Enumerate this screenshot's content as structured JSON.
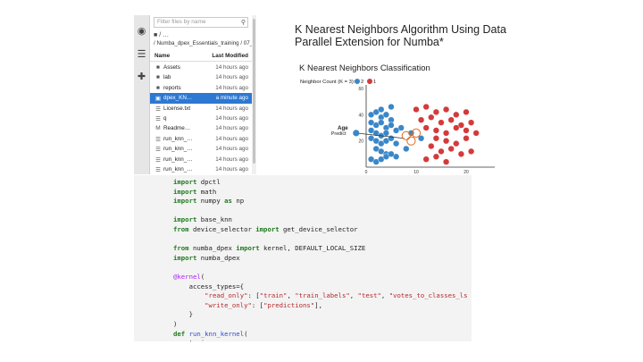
{
  "file_browser": {
    "filter_placeholder": "Filter files by name",
    "new_folder_label": "/ …",
    "path": "/ Numba_dpex_Essentials_training / 07_",
    "col_name": "Name",
    "col_modified": "Last Modified",
    "files": [
      {
        "name": "Assets",
        "modified": "14 hours ago",
        "icon": "folder-icon"
      },
      {
        "name": "lab",
        "modified": "14 hours ago",
        "icon": "folder-icon"
      },
      {
        "name": "reports",
        "modified": "14 hours ago",
        "icon": "folder-icon"
      },
      {
        "name": "dpex_KN…",
        "modified": "a minute ago",
        "icon": "notebook-icon",
        "selected": true
      },
      {
        "name": "License.txt",
        "modified": "14 hours ago",
        "icon": "file-icon"
      },
      {
        "name": "q",
        "modified": "14 hours ago",
        "icon": "file-icon"
      },
      {
        "name": "Readme…",
        "modified": "14 hours ago",
        "icon": "markdown-icon"
      },
      {
        "name": "run_knn_…",
        "modified": "14 hours ago",
        "icon": "file-icon"
      },
      {
        "name": "run_knn_…",
        "modified": "14 hours ago",
        "icon": "file-icon"
      },
      {
        "name": "run_knn_…",
        "modified": "14 hours ago",
        "icon": "file-icon"
      },
      {
        "name": "run_knn_…",
        "modified": "14 hours ago",
        "icon": "file-icon"
      }
    ]
  },
  "slide": {
    "title": "K Nearest Neighbors Algorithm Using Data Parallel Extension for Numba*",
    "chart_heading": "K Nearest Neighbors Classification"
  },
  "chart_data": {
    "type": "scatter",
    "legend_prefix": "Neighbor Count (K = 3):",
    "series": [
      {
        "name": "2",
        "color": "#3a87c8",
        "x": [
          1,
          2,
          3,
          4,
          5,
          1,
          2,
          3,
          4,
          5,
          1,
          2,
          3,
          4,
          1,
          2,
          3,
          4,
          5,
          6,
          2,
          3,
          4,
          6,
          1,
          2,
          3,
          4,
          5,
          7,
          9,
          11,
          3,
          5,
          6,
          8
        ],
        "y": [
          40,
          42,
          38,
          40,
          36,
          34,
          32,
          34,
          30,
          32,
          28,
          26,
          24,
          26,
          22,
          20,
          18,
          20,
          22,
          18,
          14,
          12,
          10,
          8,
          6,
          4,
          6,
          8,
          10,
          30,
          26,
          22,
          44,
          46,
          28,
          14
        ]
      },
      {
        "name": "1",
        "color": "#d43a3a",
        "x": [
          10,
          12,
          14,
          16,
          18,
          20,
          11,
          13,
          15,
          17,
          19,
          21,
          12,
          14,
          16,
          18,
          20,
          22,
          14,
          16,
          18,
          20,
          13,
          15,
          17,
          19,
          21,
          12,
          14,
          16
        ],
        "y": [
          44,
          46,
          42,
          44,
          40,
          42,
          36,
          38,
          34,
          36,
          32,
          34,
          30,
          28,
          26,
          30,
          28,
          26,
          22,
          20,
          18,
          22,
          16,
          12,
          14,
          10,
          12,
          6,
          8,
          4
        ]
      }
    ],
    "query_point": {
      "label": "Predict",
      "x": -2,
      "y": 26
    },
    "y_label": "Age",
    "x_ticks": [
      0,
      10,
      20
    ],
    "y_ticks": [
      20,
      40,
      60
    ],
    "xlim": [
      0,
      25
    ],
    "ylim": [
      0,
      60
    ]
  },
  "code": {
    "lines": [
      [
        [
          "kw",
          "import"
        ],
        [
          "",
          ""
        ],
        [
          "t",
          " dpctl"
        ]
      ],
      [
        [
          "kw",
          "import"
        ],
        [
          "t",
          " math"
        ]
      ],
      [
        [
          "kw",
          "import"
        ],
        [
          "t",
          " numpy "
        ],
        [
          "kw",
          "as"
        ],
        [
          "t",
          " np"
        ]
      ],
      [
        [
          "t",
          ""
        ]
      ],
      [
        [
          "kw",
          "import"
        ],
        [
          "t",
          " base_knn"
        ]
      ],
      [
        [
          "kw",
          "from"
        ],
        [
          "t",
          " device_selector "
        ],
        [
          "kw",
          "import"
        ],
        [
          "t",
          " get_device_selector"
        ]
      ],
      [
        [
          "t",
          ""
        ]
      ],
      [
        [
          "kw",
          "from"
        ],
        [
          "t",
          " numba_dpex "
        ],
        [
          "kw",
          "import"
        ],
        [
          "t",
          " kernel, DEFAULT_LOCAL_SIZE"
        ]
      ],
      [
        [
          "kw",
          "import"
        ],
        [
          "t",
          " numba_dpex"
        ]
      ],
      [
        [
          "t",
          ""
        ]
      ],
      [
        [
          "dc",
          "@kernel"
        ],
        [
          "t",
          "("
        ]
      ],
      [
        [
          "t",
          "    access_types={"
        ]
      ],
      [
        [
          "t",
          "        "
        ],
        [
          "st",
          "\"read_only\""
        ],
        [
          "t",
          ": ["
        ],
        [
          "st",
          "\"train\""
        ],
        [
          "t",
          ", "
        ],
        [
          "st",
          "\"train_labels\""
        ],
        [
          "t",
          ", "
        ],
        [
          "st",
          "\"test\""
        ],
        [
          "t",
          ", "
        ],
        [
          "st",
          "\"votes_to_classes_ls"
        ]
      ],
      [
        [
          "t",
          "        "
        ],
        [
          "st",
          "\"write_only\""
        ],
        [
          "t",
          ": ["
        ],
        [
          "st",
          "\"predictions\""
        ],
        [
          "t",
          "],"
        ]
      ],
      [
        [
          "t",
          "    }"
        ]
      ],
      [
        [
          "t",
          ")"
        ]
      ],
      [
        [
          "kw",
          "def"
        ],
        [
          "t",
          " "
        ],
        [
          "fn",
          "run_knn_kernel"
        ],
        [
          "t",
          "("
        ]
      ],
      [
        [
          "t",
          "    train"
        ]
      ]
    ]
  }
}
